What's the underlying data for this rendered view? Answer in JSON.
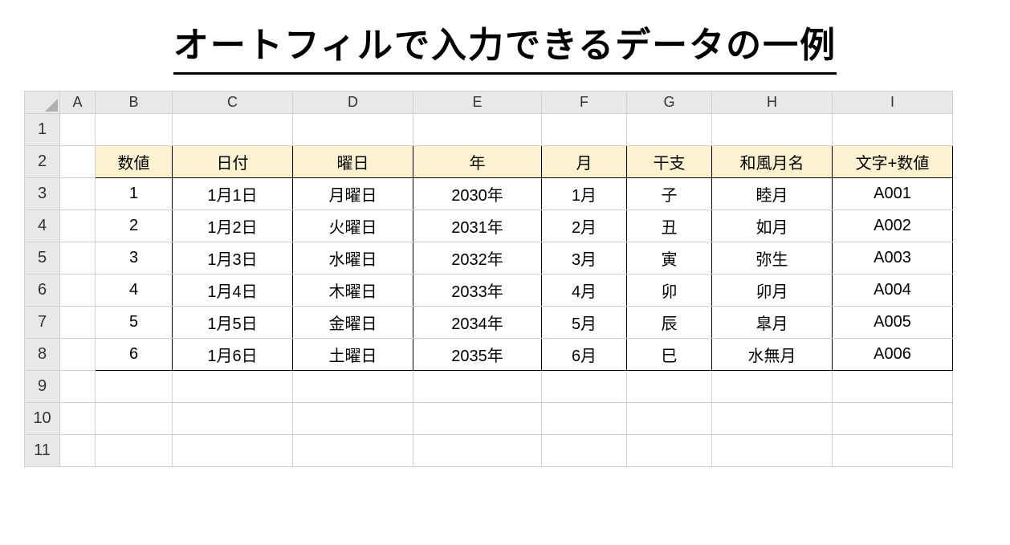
{
  "title": "オートフィルで入力できるデータの一例",
  "columns": [
    "A",
    "B",
    "C",
    "D",
    "E",
    "F",
    "G",
    "H",
    "I"
  ],
  "rows": [
    "1",
    "2",
    "3",
    "4",
    "5",
    "6",
    "7",
    "8",
    "9",
    "10",
    "11"
  ],
  "headers": {
    "B": "数値",
    "C": "日付",
    "D": "曜日",
    "E": "年",
    "F": "月",
    "G": "干支",
    "H": "和風月名",
    "I": "文字+数値"
  },
  "data": [
    {
      "B": "1",
      "C": "1月1日",
      "D": "月曜日",
      "E": "2030年",
      "F": "1月",
      "G": "子",
      "H": "睦月",
      "I": "A001"
    },
    {
      "B": "2",
      "C": "1月2日",
      "D": "火曜日",
      "E": "2031年",
      "F": "2月",
      "G": "丑",
      "H": "如月",
      "I": "A002"
    },
    {
      "B": "3",
      "C": "1月3日",
      "D": "水曜日",
      "E": "2032年",
      "F": "3月",
      "G": "寅",
      "H": "弥生",
      "I": "A003"
    },
    {
      "B": "4",
      "C": "1月4日",
      "D": "木曜日",
      "E": "2033年",
      "F": "4月",
      "G": "卯",
      "H": "卯月",
      "I": "A004"
    },
    {
      "B": "5",
      "C": "1月5日",
      "D": "金曜日",
      "E": "2034年",
      "F": "5月",
      "G": "辰",
      "H": "皐月",
      "I": "A005"
    },
    {
      "B": "6",
      "C": "1月6日",
      "D": "土曜日",
      "E": "2035年",
      "F": "6月",
      "G": "巳",
      "H": "水無月",
      "I": "A006"
    }
  ]
}
